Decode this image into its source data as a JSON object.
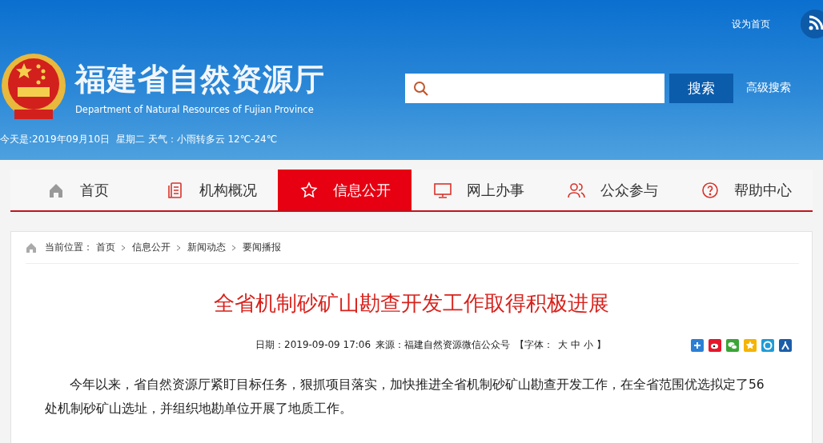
{
  "header": {
    "site_name": "福建省自然资源厅",
    "site_name_en": "Department of Natural Resources of Fujian Province",
    "today": "今天是:2019年09月10日  星期二 天气：小雨转多云 12℃-24℃",
    "set_home": "设为首页",
    "search": {
      "button": "搜索",
      "advanced": "高级搜索"
    }
  },
  "nav": [
    {
      "label": "首页",
      "kind": "home",
      "selected": false
    },
    {
      "label": "机构概况",
      "kind": "doc",
      "selected": false
    },
    {
      "label": "信息公开",
      "kind": "star",
      "selected": true
    },
    {
      "label": "网上办事",
      "kind": "monitor",
      "selected": false
    },
    {
      "label": "公众参与",
      "kind": "people",
      "selected": false
    },
    {
      "label": "帮助中心",
      "kind": "help",
      "selected": false
    }
  ],
  "breadcrumb": {
    "label": "当前位置：",
    "items": [
      "首页",
      "信息公开",
      "新闻动态",
      "要闻播报"
    ]
  },
  "article": {
    "title": "全省机制砂矿山勘查开发工作取得积极进展",
    "date": "日期：2019-09-09 17:06",
    "source": "来源：福建自然资源微信公众号",
    "font_label": "【字体：",
    "font_sizes": [
      "大",
      "中",
      "小"
    ],
    "font_end": "】",
    "share": [
      {
        "kind": "plus",
        "color": "#2b7fd4"
      },
      {
        "kind": "weibo",
        "color": "#e6162d"
      },
      {
        "kind": "wechat",
        "color": "#3aa436"
      },
      {
        "kind": "qzone",
        "color": "#f5b400"
      },
      {
        "kind": "pengyou",
        "color": "#1e9bd7"
      },
      {
        "kind": "renren",
        "color": "#1b5ea8"
      }
    ],
    "paragraphs": [
      "今年以来，省自然资源厅紧盯目标任务，狠抓项目落实，加快推进全省机制砂矿山勘查开发工作，在全省范围优选拟定了56处机制砂矿山选址，并组织地勘单位开展了地质工作。"
    ]
  }
}
